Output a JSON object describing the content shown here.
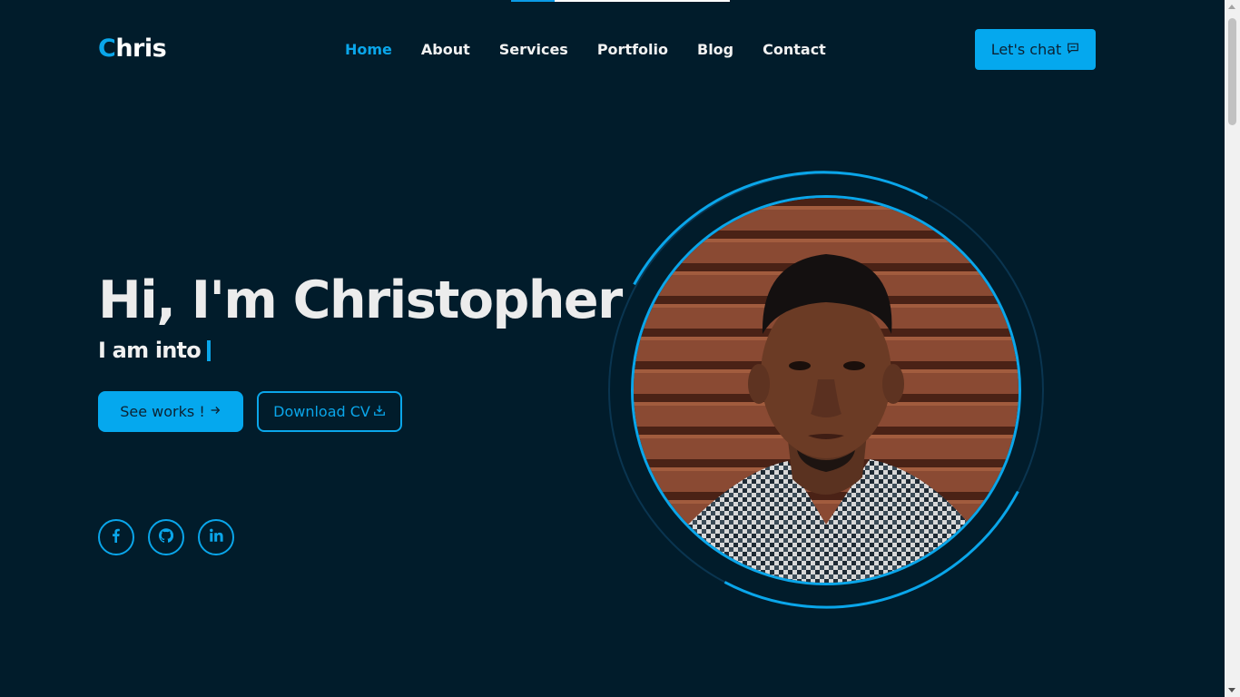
{
  "brand": {
    "logo_first": "C",
    "logo_rest": "hris"
  },
  "nav": {
    "items": [
      {
        "label": "Home",
        "active": true
      },
      {
        "label": "About",
        "active": false
      },
      {
        "label": "Services",
        "active": false
      },
      {
        "label": "Portfolio",
        "active": false
      },
      {
        "label": "Blog",
        "active": false
      },
      {
        "label": "Contact",
        "active": false
      }
    ]
  },
  "header": {
    "chat_label": "Let's chat",
    "chat_icon": "message-square-icon"
  },
  "hero": {
    "title": "Hi, I'm Christopher",
    "subtitle": "I am into",
    "primary_label": "See works !",
    "primary_icon": "arrow-right-icon",
    "secondary_label": "Download CV",
    "secondary_icon": "download-icon"
  },
  "socials": [
    {
      "icon": "facebook-icon"
    },
    {
      "icon": "github-icon"
    },
    {
      "icon": "linkedin-icon"
    }
  ],
  "scroll_progress": 0.2,
  "colors": {
    "background": "#011c2b",
    "accent": "#0aa6ea",
    "text": "#ececec",
    "button_text": "#0c2233"
  }
}
